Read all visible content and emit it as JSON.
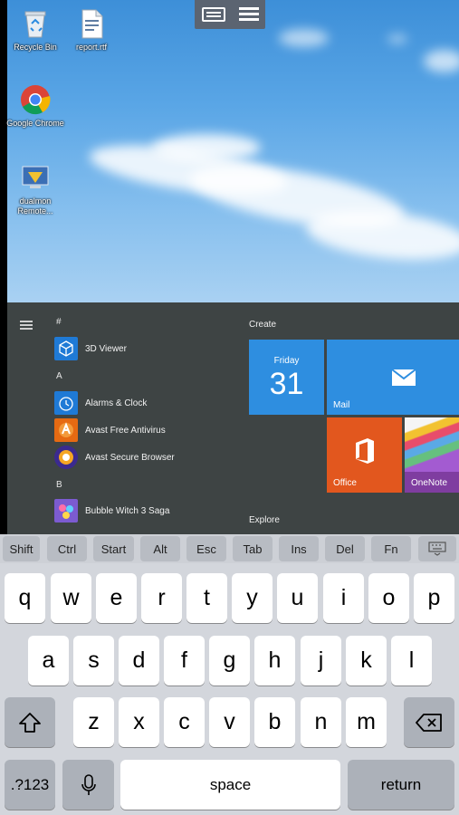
{
  "desktop": {
    "icons": [
      {
        "label": "Recycle Bin",
        "icon": "recycle-bin-icon"
      },
      {
        "label": "report.rtf",
        "icon": "document-icon"
      },
      {
        "label": "Google Chrome",
        "icon": "chrome-icon"
      },
      {
        "label": "dualmon Remote...",
        "icon": "remote-app-icon"
      }
    ]
  },
  "remote_toolbar": {
    "keyboard_icon": "keyboard-icon",
    "menu_icon": "menu-icon"
  },
  "start_menu": {
    "groups": [
      {
        "letter": "#",
        "apps": [
          {
            "label": "3D Viewer",
            "color": "#1f7ad6"
          }
        ]
      },
      {
        "letter": "A",
        "apps": [
          {
            "label": "Alarms & Clock",
            "color": "#1f7ad6"
          },
          {
            "label": "Avast Free Antivirus",
            "color": "#e66a12"
          },
          {
            "label": "Avast Secure Browser",
            "color": "#3b2a8f"
          }
        ]
      },
      {
        "letter": "B",
        "apps": [
          {
            "label": "Bubble Witch 3 Saga",
            "color": "#7c5bd1"
          }
        ]
      }
    ],
    "create_title": "Create",
    "explore_title": "Explore",
    "tiles": {
      "calendar": {
        "day": "Friday",
        "date": "31",
        "color": "#2e8ee0"
      },
      "mail": {
        "label": "Mail",
        "color": "#2e8ee0"
      },
      "office": {
        "label": "Office",
        "color": "#e2571e"
      },
      "onenote": {
        "label": "OneNote",
        "color": "#7f3da0"
      }
    }
  },
  "keyboard": {
    "modifiers": [
      "Shift",
      "Ctrl",
      "Start",
      "Alt",
      "Esc",
      "Tab",
      "Ins",
      "Del",
      "Fn"
    ],
    "row1": [
      "q",
      "w",
      "e",
      "r",
      "t",
      "y",
      "u",
      "i",
      "o",
      "p"
    ],
    "row2": [
      "a",
      "s",
      "d",
      "f",
      "g",
      "h",
      "j",
      "k",
      "l"
    ],
    "row3": [
      "z",
      "x",
      "c",
      "v",
      "b",
      "n",
      "m"
    ],
    "numbers_label": ".?123",
    "space_label": "space",
    "return_label": "return"
  }
}
